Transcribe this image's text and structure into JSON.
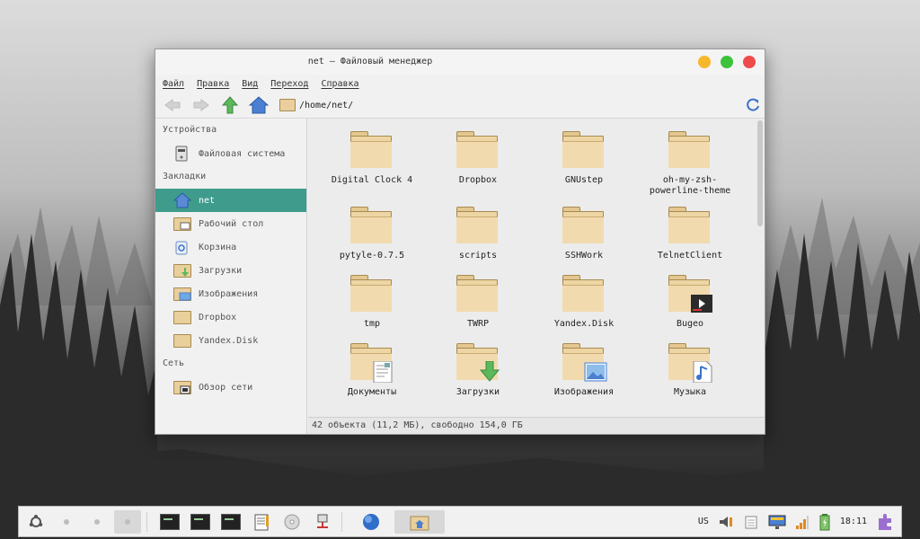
{
  "window": {
    "title": "net — Файловый менеджер"
  },
  "menu": [
    "Файл",
    "Правка",
    "Вид",
    "Переход",
    "Справка"
  ],
  "toolbar": {
    "path": "/home/net/"
  },
  "sidebar": {
    "devices_heading": "Устройства",
    "devices": [
      {
        "label": "Файловая система",
        "icon": "drive-icon"
      }
    ],
    "bookmarks_heading": "Закладки",
    "bookmarks": [
      {
        "label": "net",
        "icon": "home-icon",
        "active": true
      },
      {
        "label": "Рабочий стол",
        "icon": "desktop-folder-icon"
      },
      {
        "label": "Корзина",
        "icon": "trash-icon"
      },
      {
        "label": "Загрузки",
        "icon": "downloads-folder-icon"
      },
      {
        "label": "Изображения",
        "icon": "pictures-folder-icon"
      },
      {
        "label": "Dropbox",
        "icon": "folder-icon"
      },
      {
        "label": "Yandex.Disk",
        "icon": "folder-icon"
      }
    ],
    "network_heading": "Сеть",
    "network": [
      {
        "label": "Обзор сети",
        "icon": "network-icon"
      }
    ]
  },
  "files": [
    {
      "name": "Digital Clock 4",
      "icon": "folder-icon"
    },
    {
      "name": "Dropbox",
      "icon": "folder-icon"
    },
    {
      "name": "GNUstep",
      "icon": "folder-icon"
    },
    {
      "name": "oh-my-zsh-\npowerline-theme",
      "icon": "folder-icon"
    },
    {
      "name": "pytyle-0.7.5",
      "icon": "folder-icon"
    },
    {
      "name": "scripts",
      "icon": "folder-icon"
    },
    {
      "name": "SSHWork",
      "icon": "folder-icon"
    },
    {
      "name": "TelnetClient",
      "icon": "folder-icon"
    },
    {
      "name": "tmp",
      "icon": "folder-icon"
    },
    {
      "name": "TWRP",
      "icon": "folder-icon"
    },
    {
      "name": "Yandex.Disk",
      "icon": "folder-icon"
    },
    {
      "name": "Bugeo",
      "icon": "video-folder-icon"
    },
    {
      "name": "Документы",
      "icon": "documents-folder-icon"
    },
    {
      "name": "Загрузки",
      "icon": "downloads-folder-icon"
    },
    {
      "name": "Изображения",
      "icon": "pictures-folder-icon"
    },
    {
      "name": "Музыка",
      "icon": "music-folder-icon"
    }
  ],
  "status": "42 объекта (11,2 МБ), свободно 154,0 ГБ",
  "panel": {
    "keyboard_layout": "US",
    "clock": "18:11"
  },
  "colors": {
    "accent": "#3f9b8c",
    "folder": "#eed5a4",
    "close": "#ee4b4b",
    "minimize": "#f6b82a",
    "maximize": "#3cc33c"
  }
}
